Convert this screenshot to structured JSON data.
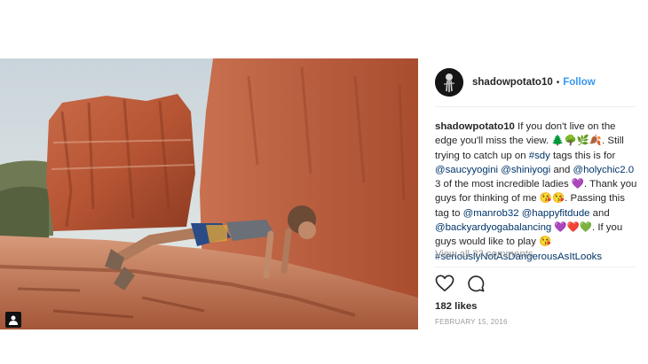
{
  "post": {
    "username": "shadowpotato10",
    "separator": "•",
    "follow_label": "Follow",
    "caption": {
      "username": "shadowpotato10",
      "t1": " If you don't live on the edge you'll miss the view. ",
      "e1": "🌲🌳🌿🍂",
      "t2": ". Still trying to catch up on ",
      "tag1": "#sdy",
      "t3": " tags this is for ",
      "m1": "@saucyyogini",
      "t4": " ",
      "m2": "@shiniyogi",
      "t5": " and ",
      "m3": "@holychic2.0",
      "t6": " 3 of the most incredible ladies ",
      "e2": "💜",
      "t7": ". Thank you guys for thinking of me ",
      "e3": "😘😘",
      "t8": ". Passing this tag to ",
      "m4": "@manrob32",
      "t9": " ",
      "m5": "@happyfitdude",
      "t10": " and ",
      "m6": "@backyardyogabalancing",
      "t11": " ",
      "e4": "💜❤️💚",
      "t12": ". If you guys would like to play ",
      "e5": "😘",
      "t13": " ",
      "tag2": "#seriouslyNotAsDangerousAsItLooks"
    },
    "view_all_comments": "View all 33 comments",
    "likes": "182 likes",
    "date": "FEBRUARY 15, 2016",
    "icons": [
      "heart-icon",
      "comment-icon",
      "user-tag-icon"
    ],
    "colors": {
      "link": "#3897f0",
      "mention": "#003569",
      "muted": "#999999"
    }
  }
}
